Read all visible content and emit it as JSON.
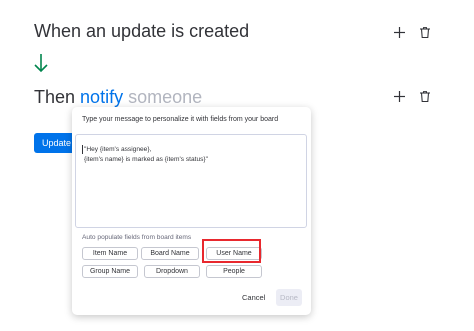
{
  "trigger": {
    "title": "When an update is created"
  },
  "action": {
    "prefix": "Then",
    "verb": "notify",
    "target": "someone"
  },
  "update_button": {
    "label": "Update"
  },
  "popup": {
    "header": "Type your message to personalize it with fields from your board",
    "message_lines": [
      "\"Hey {item's assignee},",
      "{item's name} is marked as {item's status}\""
    ],
    "auto_populate_label": "Auto populate fields from board items",
    "fields": [
      "Item Name",
      "Board Name",
      "User Name",
      "Group Name",
      "Dropdown",
      "People"
    ],
    "highlighted_field": "User Name",
    "cancel_label": "Cancel",
    "done_label": "Done"
  },
  "colors": {
    "accent": "#0073ea",
    "highlight": "#e8282e",
    "arrow": "#00854d"
  },
  "icons": {
    "plus": "plus-icon",
    "trash": "trash-icon",
    "arrow": "arrow-down-icon"
  }
}
